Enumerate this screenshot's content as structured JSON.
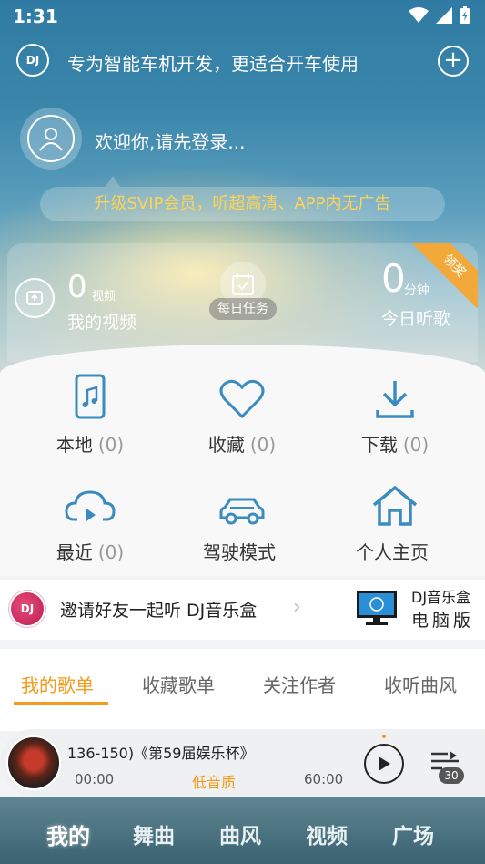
{
  "status_bar": {
    "time": "1:31"
  },
  "top_bar": {
    "logo_text": "DJ",
    "slogan": "专为智能车机开发，更适合开车使用"
  },
  "profile": {
    "login_prompt": "欢迎你,请先登录..."
  },
  "vip_banner": {
    "text": "升级SVIP会员，听超高清、APP内无广告"
  },
  "stats": {
    "videos_count": "0",
    "videos_unit": "视频",
    "videos_label": "我的视频",
    "daily_task_label": "每日任务",
    "listen_minutes": "0",
    "listen_unit": "分钟",
    "listen_label": "今日听歌",
    "reward_ribbon": "领奖"
  },
  "grid": [
    {
      "label": "本地",
      "count": "(0)",
      "icon": "phone-music-icon"
    },
    {
      "label": "收藏",
      "count": "(0)",
      "icon": "heart-icon"
    },
    {
      "label": "下载",
      "count": "(0)",
      "icon": "download-icon"
    },
    {
      "label": "最近",
      "count": "(0)",
      "icon": "cloud-play-icon"
    },
    {
      "label": "驾驶模式",
      "count": "",
      "icon": "car-icon"
    },
    {
      "label": "个人主页",
      "count": "",
      "icon": "home-icon"
    }
  ],
  "invite": {
    "badge": "DJ",
    "text": "邀请好友一起听 DJ音乐盒",
    "pc_line1": "DJ音乐盒",
    "pc_line2": "电脑版"
  },
  "tabs": [
    {
      "label": "我的歌单",
      "active": true
    },
    {
      "label": "收藏歌单",
      "active": false
    },
    {
      "label": "关注作者",
      "active": false
    },
    {
      "label": "收听曲风",
      "active": false
    }
  ],
  "player": {
    "title": "136-150)《第59届娱乐杯》",
    "current_time": "00:00",
    "quality": "低音质",
    "duration": "60:00",
    "queue_count": "30"
  },
  "bottom_nav": [
    {
      "label": "我的",
      "active": true
    },
    {
      "label": "舞曲",
      "active": false
    },
    {
      "label": "曲风",
      "active": false
    },
    {
      "label": "视频",
      "active": false
    },
    {
      "label": "广场",
      "active": false
    }
  ],
  "colors": {
    "accent": "#f29b1c",
    "icon_blue": "#3a8bc0",
    "vip_text": "#ffd457",
    "nav_bg": "#3a6270"
  }
}
